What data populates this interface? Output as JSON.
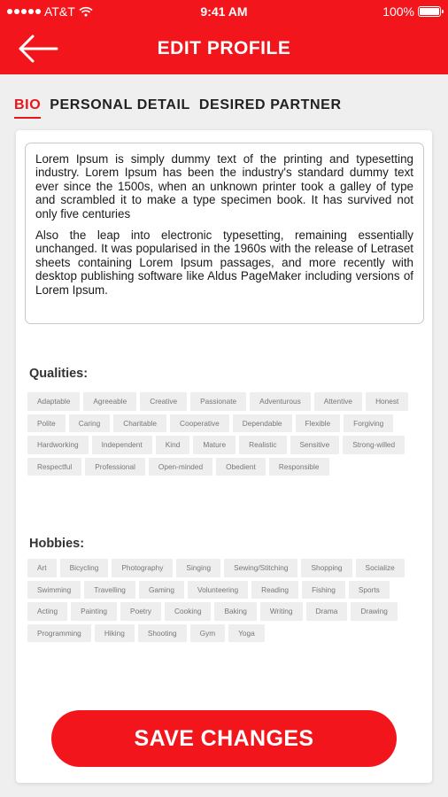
{
  "status_bar": {
    "carrier": "AT&T",
    "time": "9:41 AM",
    "battery": "100%"
  },
  "header": {
    "title": "EDIT PROFILE",
    "back_icon": "arrow-left-icon"
  },
  "tabs": [
    {
      "label": "BIO",
      "active": true
    },
    {
      "label": "PERSONAL DETAIL",
      "active": false
    },
    {
      "label": "DESIRED PARTNER",
      "active": false
    }
  ],
  "bio": {
    "paragraphs": [
      "Lorem Ipsum is simply dummy text of the printing and typesetting industry. Lorem Ipsum has been the industry's standard dummy text ever since the 1500s, when an unknown printer took a galley of type and scrambled it to make a type specimen book. It has survived not only five centuries",
      "Also the leap into electronic typesetting, remaining essentially unchanged. It was popularised in the 1960s with the release of Letraset sheets containing Lorem Ipsum passages, and more recently with desktop publishing software like Aldus PageMaker including versions of Lorem Ipsum."
    ]
  },
  "qualities": {
    "label": "Qualities:",
    "items": [
      "Adaptable",
      "Agreeable",
      "Creative",
      "Passionate",
      "Adventurous",
      "Attentive",
      "Honest",
      "Polite",
      "Caring",
      "Charitable",
      "Cooperative",
      "Dependable",
      "Flexible",
      "Forgiving",
      "Hardworking",
      "Independent",
      "Kind",
      "Mature",
      "Realistic",
      "Sensitive",
      "Strong-willed",
      "Respectful",
      "Professional",
      "Open-minded",
      "Obedient",
      "Responsible"
    ]
  },
  "hobbies": {
    "label": "Hobbies:",
    "items": [
      "Art",
      "Bicycling",
      "Photography",
      "Singing",
      "Sewing/Stitching",
      "Shopping",
      "Socialize",
      "Swimming",
      "Travelling",
      "Gaming",
      "Volunteering",
      "Reading",
      "Fishing",
      "Sports",
      "Acting",
      "Painting",
      "Poetry",
      "Cooking",
      "Baking",
      "Writing",
      "Drama",
      "Drawing",
      "Programming",
      "Hiking",
      "Shooting",
      "Gym",
      "Yoga"
    ]
  },
  "save_button": {
    "label": "SAVE CHANGES"
  },
  "colors": {
    "accent": "#f2161c",
    "chip_bg": "#eeeeef",
    "page_bg": "#efefef"
  }
}
